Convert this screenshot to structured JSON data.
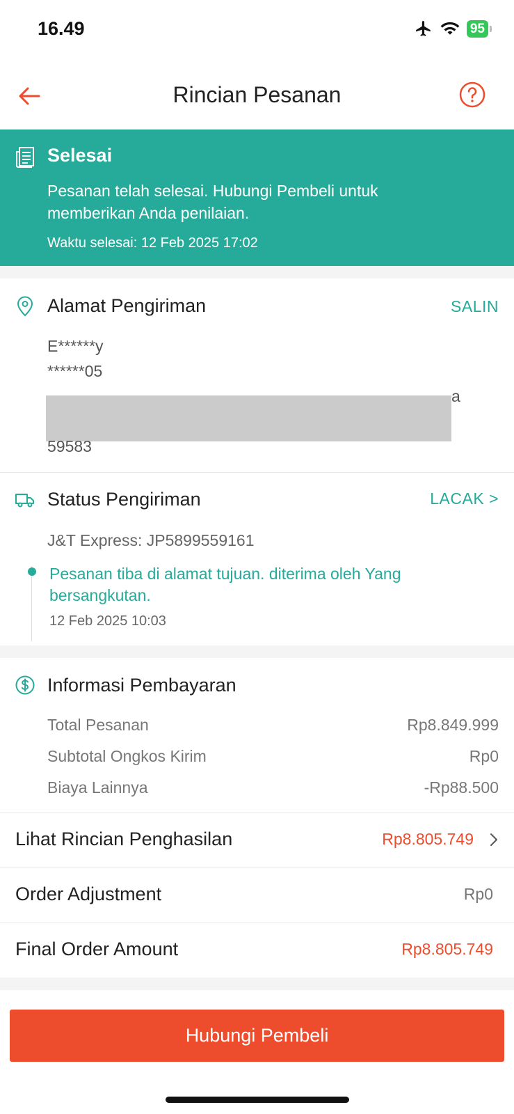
{
  "status_bar": {
    "time": "16.49",
    "battery": "95"
  },
  "nav": {
    "title": "Rincian Pesanan",
    "back_icon": "arrow-left-icon",
    "help_icon": "question-circle-icon"
  },
  "banner": {
    "title": "Selesai",
    "description": "Pesanan telah selesai. Hubungi Pembeli untuk memberikan Anda penilaian.",
    "time": "Waktu selesai: 12 Feb 2025 17:02",
    "color": "#26aa99"
  },
  "address": {
    "title": "Alamat Pengiriman",
    "action": "SALIN",
    "name": "E******y",
    "phone": "******05",
    "line_fragment": "a",
    "postal": "59583"
  },
  "shipping": {
    "title": "Status Pengiriman",
    "action": "LACAK >",
    "courier": "J&T Express: JP5899559161",
    "status": "Pesanan tiba di alamat tujuan. diterima oleh Yang bersangkutan.",
    "time": "12 Feb 2025 10:03"
  },
  "payment": {
    "title": "Informasi Pembayaran",
    "rows": [
      {
        "label": "Total Pesanan",
        "value": "Rp8.849.999"
      },
      {
        "label": "Subtotal Ongkos Kirim",
        "value": "Rp0"
      },
      {
        "label": "Biaya Lainnya",
        "value": "-Rp88.500"
      }
    ]
  },
  "summary": {
    "income": {
      "label": "Lihat Rincian Penghasilan",
      "value": "Rp8.805.749"
    },
    "adjustment": {
      "label": "Order Adjustment",
      "value": "Rp0"
    },
    "final": {
      "label": "Final Order Amount",
      "value": "Rp8.805.749"
    }
  },
  "contact_button": "Hubungi Pembeli",
  "colors": {
    "accent": "#ee4d2d",
    "teal": "#26aa99"
  }
}
